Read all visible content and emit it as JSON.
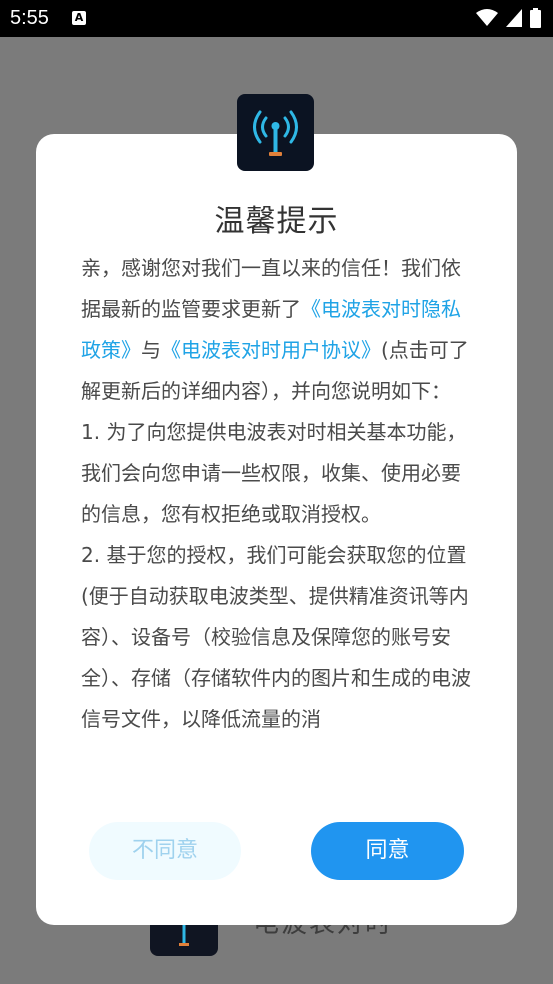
{
  "status_bar": {
    "time": "5:55",
    "notification_icon_label": "A",
    "icons": [
      "wifi-icon",
      "signal-icon",
      "battery-icon"
    ]
  },
  "background_app": {
    "name": "电波表对时"
  },
  "dialog": {
    "title": "温馨提示",
    "intro_part1": "亲，感谢您对我们一直以来的信任！我们依据最新的监管要求更新了",
    "privacy_link": "《电波表对时隐私政策》",
    "connector": "与",
    "agreement_link": "《电波表对时用户协议》",
    "intro_part2": "(点击可了解更新后的详细内容），并向您说明如下：",
    "item1": "1. 为了向您提供电波表对时相关基本功能，我们会向您申请一些权限，收集、使用必要的信息，您有权拒绝或取消授权。",
    "item2": "2. 基于您的授权，我们可能会获取您的位置 (便于自动获取电波类型、提供精准资讯等内容）、设备号（校验信息及保障您的账号安全）、存储（存储软件内的图片和生成的电波信号文件，以降低流量的消",
    "disagree_label": "不同意",
    "agree_label": "同意"
  },
  "colors": {
    "overlay": "#7b7b7b",
    "link": "#1fa3e6",
    "agree_button": "#2095f0",
    "disagree_button_bg": "#f0fbff",
    "disagree_button_text": "#9fd2ee",
    "logo_bg": "#0b1322"
  }
}
